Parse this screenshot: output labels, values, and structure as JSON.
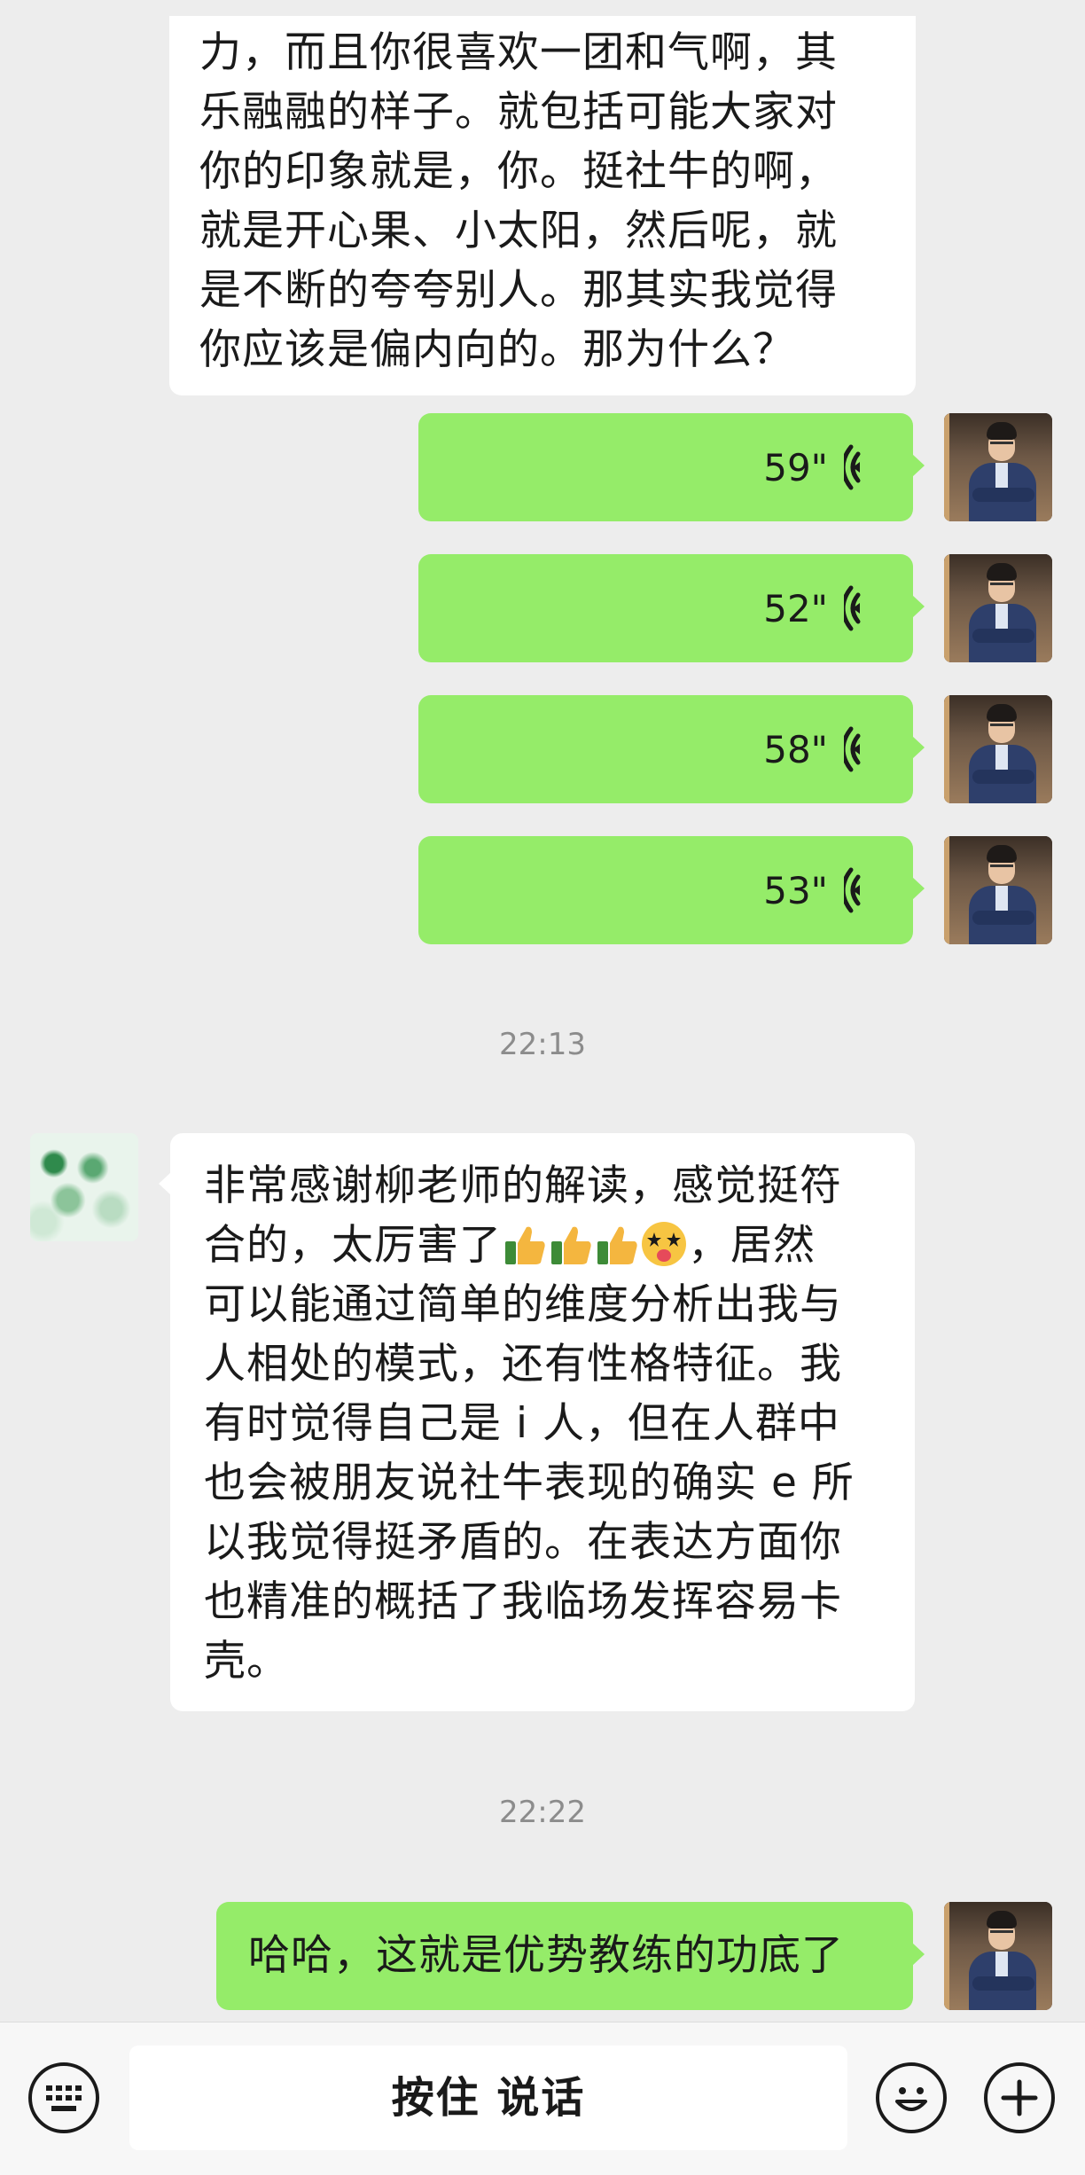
{
  "messages": {
    "incoming_1": "力，而且你很喜欢一团和气啊，其\n乐融融的样子。就包括可能大家对\n你的印象就是，你。挺社牛的啊，\n就是开心果、小太阳，然后呢，就\n是不断的夸夸别人。那其实我觉得\n你应该是偏内向的。那为什么？",
    "voices": [
      {
        "duration": "59\""
      },
      {
        "duration": "52\""
      },
      {
        "duration": "58\""
      },
      {
        "duration": "53\""
      }
    ],
    "time_1": "22:13",
    "incoming_2": {
      "part1": "非常感谢柳老师的解读，感觉挺符\n合的，太厉害了",
      "part2": "，居然\n可以能通过简单的维度分析出我与\n人相处的模式，还有性格特征。我\n有时觉得自己是 i 人，但在人群中\n也会被朋友说社牛表现的确实 e 所\n以我觉得挺矛盾的。在表达方面你\n也精准的概括了我临场发挥容易卡\n壳。"
    },
    "time_2": "22:22",
    "outgoing_text": "哈哈，这就是优势教练的功底了"
  },
  "input_bar": {
    "hold_to_talk": "按住 说话",
    "keyboard_icon": "keyboard-icon",
    "emoji_icon": "emoji-icon",
    "plus_icon": "plus-icon"
  },
  "colors": {
    "outgoing_bubble": "#95ec69",
    "incoming_bubble": "#ffffff",
    "background": "#ededed"
  }
}
